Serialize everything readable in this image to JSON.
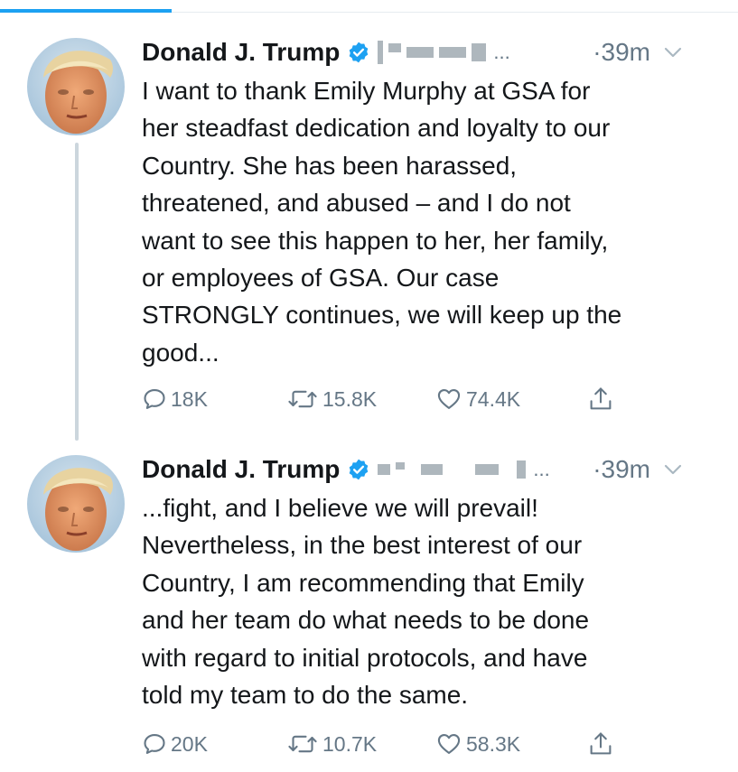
{
  "colors": {
    "accent": "#1da1f2",
    "text_primary": "#14171a",
    "text_secondary": "#657786",
    "divider": "#e6ecf0",
    "thread_line": "#ccd6dd"
  },
  "tweets": [
    {
      "author_name": "Donald J. Trump",
      "verified": true,
      "handle_ellipsis": "...",
      "timestamp": "·39m",
      "body": "I want to thank Emily Murphy at GSA for\nher steadfast dedication and loyalty to our\nCountry. She has been harassed,\nthreatened, and abused – and I do not\nwant to see this happen to her, her family,\nor employees of GSA. Our case\nSTRONGLY continues, we will keep up the\ngood...",
      "replies": "18K",
      "retweets": "15.8K",
      "likes": "74.4K",
      "icons": {
        "reply": "reply-icon",
        "retweet": "retweet-icon",
        "like": "heart-icon",
        "share": "share-icon",
        "menu": "chevron-down-icon",
        "verified": "verified-badge-icon"
      }
    },
    {
      "author_name": "Donald J. Trump",
      "verified": true,
      "handle_ellipsis": "...",
      "timestamp": "·39m",
      "body": "...fight, and I believe we will prevail!\nNevertheless, in the best interest of our\nCountry, I am recommending that Emily\nand her team do what needs to be done\nwith regard to initial protocols, and have\ntold my team to do the same.",
      "replies": "20K",
      "retweets": "10.7K",
      "likes": "58.3K",
      "icons": {
        "reply": "reply-icon",
        "retweet": "retweet-icon",
        "like": "heart-icon",
        "share": "share-icon",
        "menu": "chevron-down-icon",
        "verified": "verified-badge-icon"
      }
    }
  ]
}
